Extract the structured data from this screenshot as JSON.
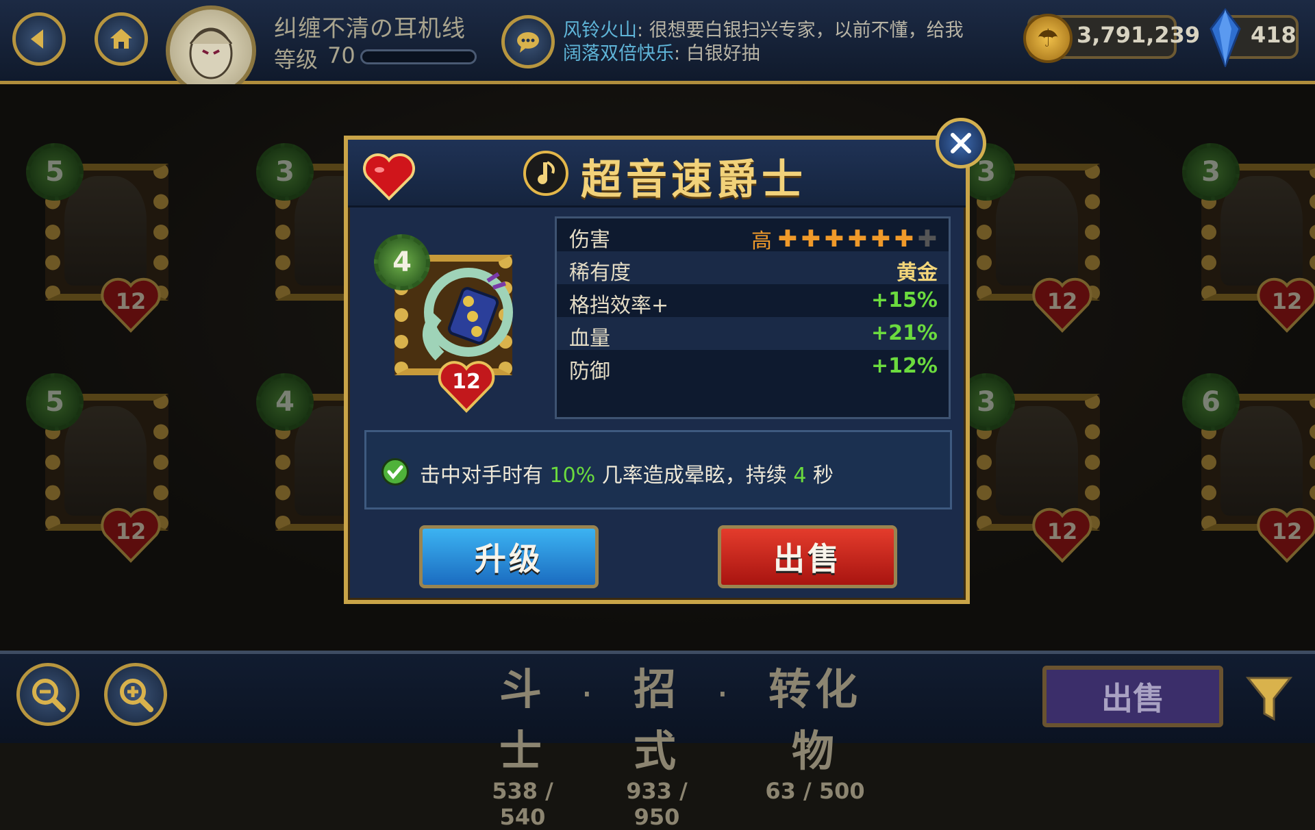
{
  "header": {
    "player_name": "纠缠不清の耳机线",
    "level_label": "等级",
    "level_value": "70",
    "xp_fraction": 0.0,
    "chat": [
      {
        "name": "风铃火山",
        "text": "很想要白银扫兴专家，以前不懂，给我"
      },
      {
        "name": "阔落双倍快乐",
        "text": "白银好抽"
      }
    ],
    "coins": "3,791,239",
    "gems": "418"
  },
  "grid_cards": [
    {
      "level": "5",
      "hp": "12"
    },
    {
      "level": "3",
      "hp": "12"
    },
    {
      "level": "3",
      "hp": "12"
    },
    {
      "level": "3",
      "hp": "12"
    },
    {
      "level": "5",
      "hp": "12"
    },
    {
      "level": "4",
      "hp": "12"
    },
    {
      "level": "3",
      "hp": "12"
    },
    {
      "level": "6",
      "hp": "12"
    }
  ],
  "dialog": {
    "title": "超音速爵士",
    "item_level": "4",
    "item_hp": "12",
    "stats": [
      {
        "label": "伤害",
        "value": "高"
      },
      {
        "label": "稀有度",
        "value": "黄金"
      },
      {
        "label": "格挡效率+",
        "value": "+15%"
      },
      {
        "label": "血量",
        "value": "+21%"
      },
      {
        "label": "防御",
        "value": "+12%"
      }
    ],
    "damage_stars_filled": 6,
    "damage_stars_total": 7,
    "ability": {
      "part1": "击中对手时有",
      "chance": "10%",
      "part2": "几率造成晕眩，持续",
      "duration": "4",
      "part3": "秒"
    },
    "upgrade_label": "升级",
    "sell_label": "出售"
  },
  "footer": {
    "categories": [
      {
        "label": "斗士",
        "count": "538 / 540"
      },
      {
        "label": "招式",
        "count": "933 / 950"
      },
      {
        "label": "转化物",
        "count": "63 / 500"
      }
    ],
    "separator": ".",
    "sell_label": "出售"
  },
  "colors": {
    "gold_border": "#c9a448",
    "upgrade_blue": "#1b6cc0",
    "sell_red": "#a81410",
    "stat_green": "#6bdb3e",
    "damage_orange": "#f09a2a"
  }
}
